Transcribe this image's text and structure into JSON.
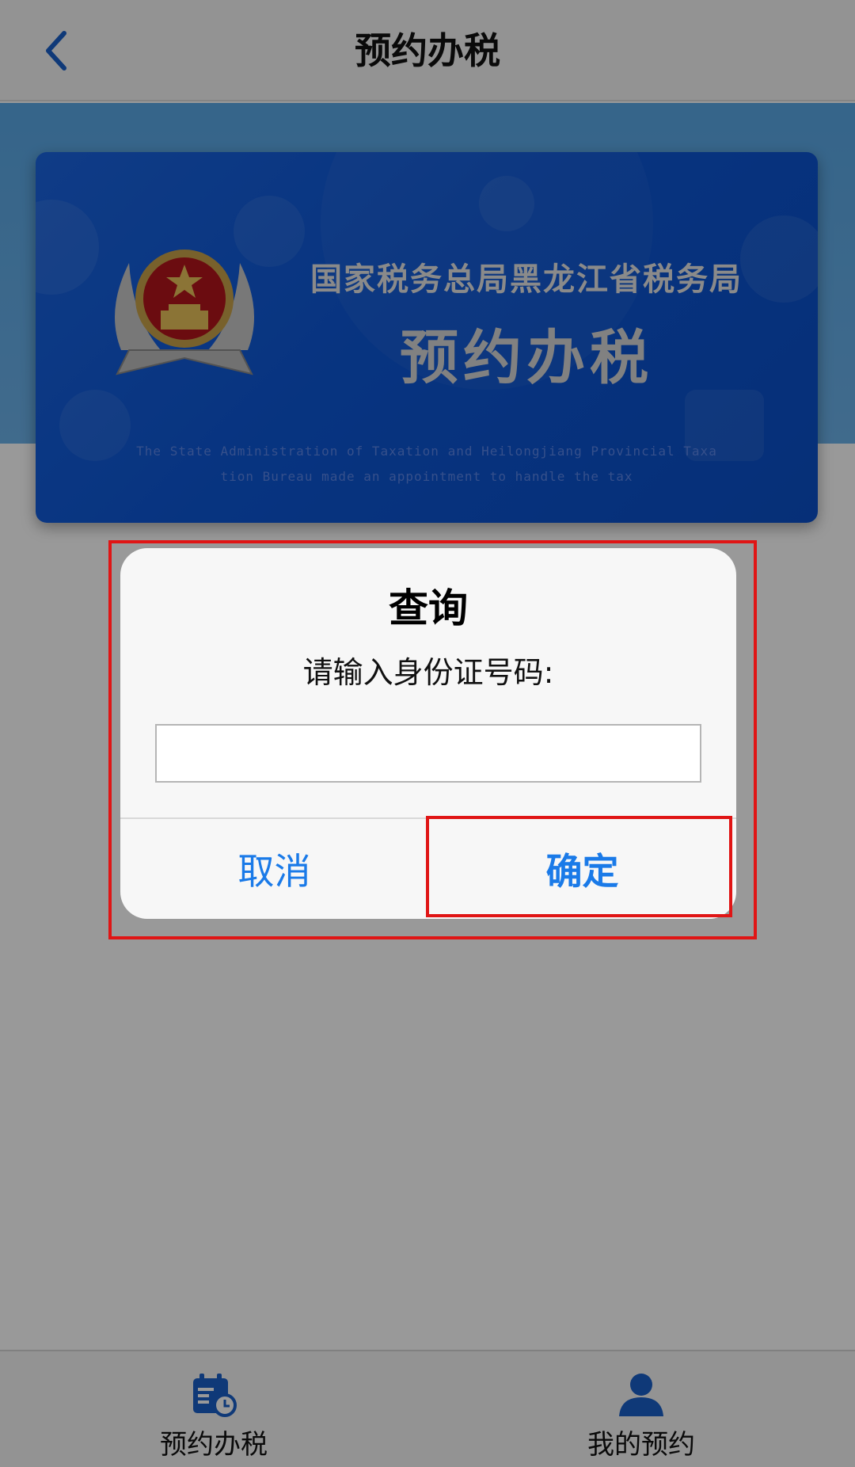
{
  "header": {
    "title": "预约办税",
    "back_icon": "chevron-left-icon"
  },
  "banner": {
    "agency": "国家税务总局黑龙江省税务局",
    "title": "预约办税",
    "subtitle_en_line1": "The State Administration of Taxation and Heilongjiang Provincial Taxa",
    "subtitle_en_line2": "tion Bureau made an appointment to handle the tax",
    "emblem": "national-emblem-icon"
  },
  "dialog": {
    "title": "查询",
    "message": "请输入身份证号码:",
    "input_value": "",
    "input_placeholder": "",
    "cancel_label": "取消",
    "confirm_label": "确定"
  },
  "tabbar": {
    "items": [
      {
        "label": "预约办税",
        "icon": "calendar-clock-icon"
      },
      {
        "label": "我的预约",
        "icon": "user-icon"
      }
    ]
  },
  "colors": {
    "accent": "#1a7ae8",
    "banner_blue": "#0d57d6",
    "highlight": "#e01515",
    "nav_icon": "#1a5fc8"
  }
}
